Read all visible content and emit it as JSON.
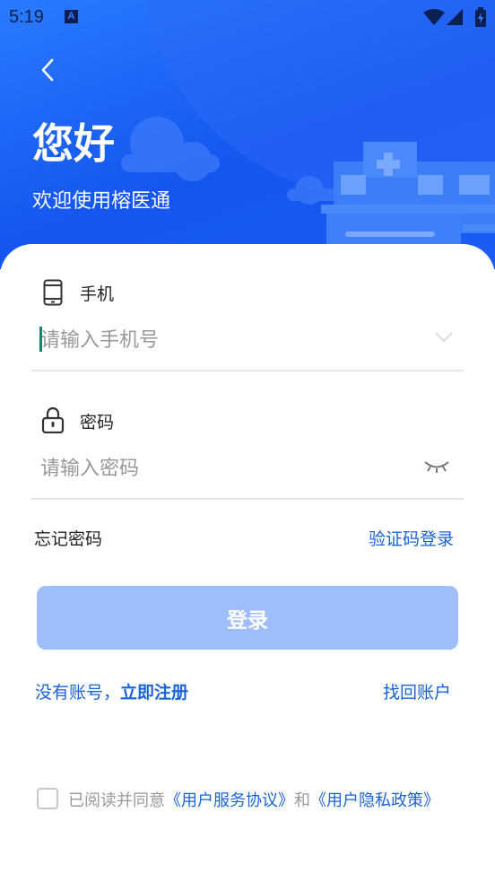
{
  "status_bar": {
    "time": "5:19",
    "app_badge": "A"
  },
  "header": {
    "greeting": "您好",
    "welcome": "欢迎使用榕医通"
  },
  "phone": {
    "label": "手机",
    "placeholder": "请输入手机号"
  },
  "password": {
    "label": "密码",
    "placeholder": "请输入密码"
  },
  "links": {
    "forgot_password": "忘记密码",
    "sms_login": "验证码登录"
  },
  "login_button": "登录",
  "register": {
    "prefix": "没有账号，",
    "action": "立即注册"
  },
  "recover_account": "找回账户",
  "agreement": {
    "prefix": "已阅读并同意",
    "terms": "《用户服务协议》",
    "and": "和",
    "privacy": "《用户隐私政策》"
  },
  "colors": {
    "primary": "#1a63d6",
    "hero": "#1556f0",
    "button_disabled": "#9dbdfb"
  }
}
